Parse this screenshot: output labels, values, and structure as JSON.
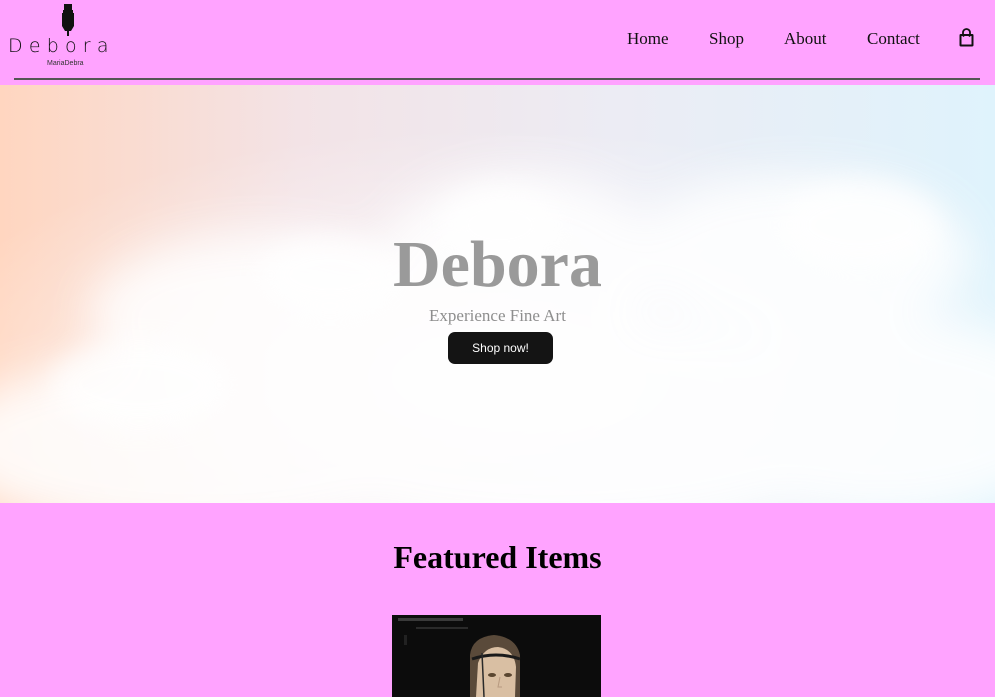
{
  "brand": {
    "name": "Debora",
    "tagline": "MariaDebra"
  },
  "nav": {
    "items": [
      {
        "label": "Home"
      },
      {
        "label": "Shop"
      },
      {
        "label": "About"
      },
      {
        "label": "Contact"
      }
    ],
    "cart_icon": "shopping-bag-icon"
  },
  "hero": {
    "title": "Debora",
    "subtitle": "Experience Fine Art",
    "cta_label": "Shop now!"
  },
  "featured": {
    "title": "Featured Items",
    "items": [
      {
        "image": "portrait-painting"
      }
    ]
  },
  "colors": {
    "page_background": "#ffa3ff",
    "button_background": "#141414",
    "hero_text": "#9a9a9a"
  }
}
